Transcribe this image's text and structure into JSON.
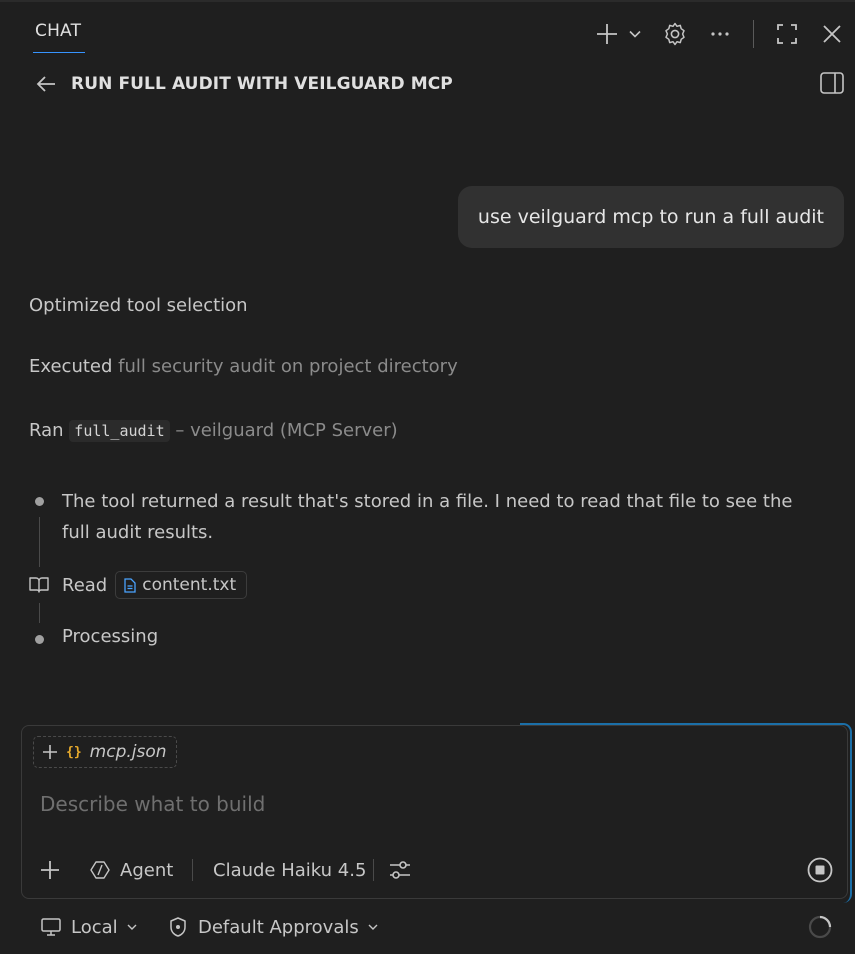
{
  "header": {
    "tab_label": "CHAT",
    "title": "RUN FULL AUDIT WITH VEILGUARD MCP"
  },
  "conversation": {
    "user_message": "use veilguard mcp to run a full audit",
    "optimized": "Optimized tool selection",
    "executed_label": "Executed",
    "executed_detail": "full security audit on project directory",
    "ran_label": "Ran",
    "ran_tool": "full_audit",
    "ran_detail": "– veilguard (MCP Server)",
    "thought": "The tool returned a result that's stored in a file. I need to read that file to see the full audit results.",
    "read_label": "Read",
    "read_file": "content.txt",
    "processing": "Processing"
  },
  "input": {
    "context_file": "mcp.json",
    "placeholder": "Describe what to build",
    "mode": "Agent",
    "model": "Claude Haiku 4.5"
  },
  "footer": {
    "location": "Local",
    "approvals": "Default Approvals"
  },
  "colors": {
    "background": "#1f1f1f",
    "accent": "#3794ff",
    "json_icon": "#e8ab2c",
    "file_icon": "#4aa3ff"
  }
}
